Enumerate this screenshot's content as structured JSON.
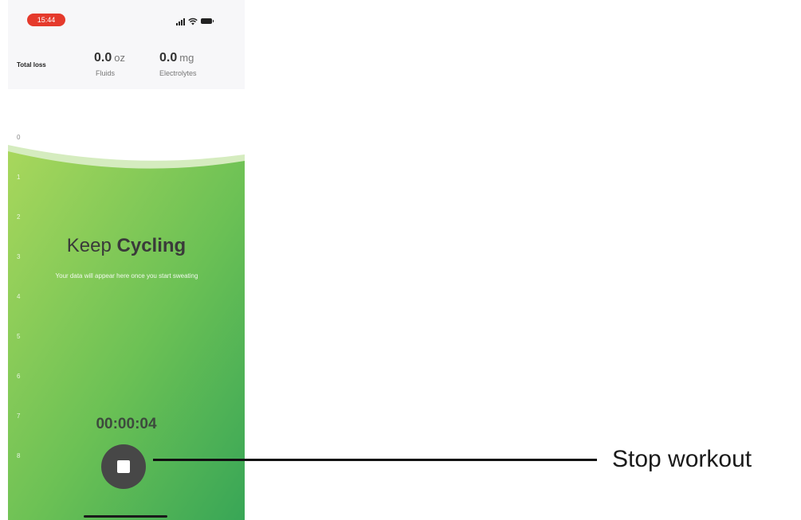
{
  "status_bar": {
    "time": "15:44",
    "time_pill_color": "#e53a2c",
    "icons": [
      "cellular-signal-icon",
      "wifi-icon",
      "battery-icon"
    ]
  },
  "summary": {
    "label": "Total loss",
    "fluids": {
      "value": "0.0",
      "unit": "oz",
      "label": "Fluids"
    },
    "electrolytes": {
      "value": "0.0",
      "unit": "mg",
      "label": "Electrolytes"
    }
  },
  "chart": {
    "y_ticks": [
      "0",
      "1",
      "2",
      "3",
      "4",
      "5",
      "6",
      "7",
      "8"
    ],
    "gradient": [
      "#a6d65a",
      "#3ca957"
    ]
  },
  "workout": {
    "headline_prefix": "Keep",
    "headline_activity": "Cycling",
    "message": "Your data will appear here once you start sweating",
    "timer": "00:00:04",
    "stop_icon": "stop-square-icon"
  },
  "annotation": {
    "label": "Stop workout"
  }
}
